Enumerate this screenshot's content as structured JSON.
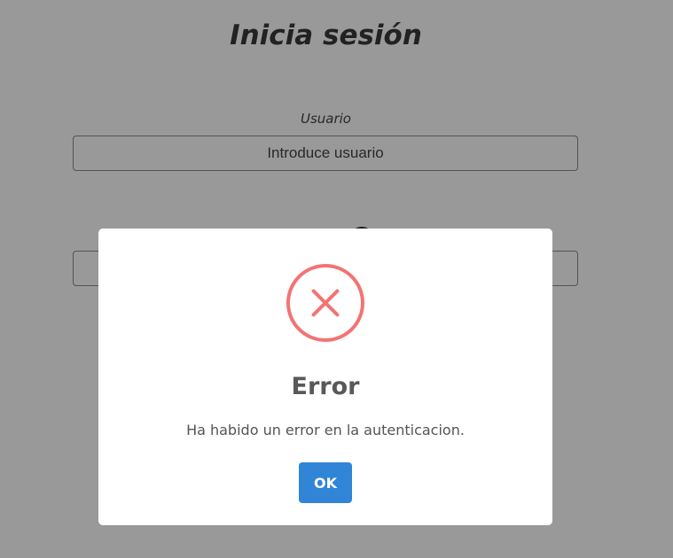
{
  "login": {
    "title": "Inicia sesión",
    "user_label": "Usuario",
    "user_placeholder": "Introduce usuario",
    "password_placeholder": ""
  },
  "alert": {
    "icon": "error-x-icon",
    "icon_color": "#f27474",
    "title": "Error",
    "message": "Ha habido un error en la autenticacion.",
    "ok_label": "OK",
    "ok_color": "#3085d6"
  }
}
